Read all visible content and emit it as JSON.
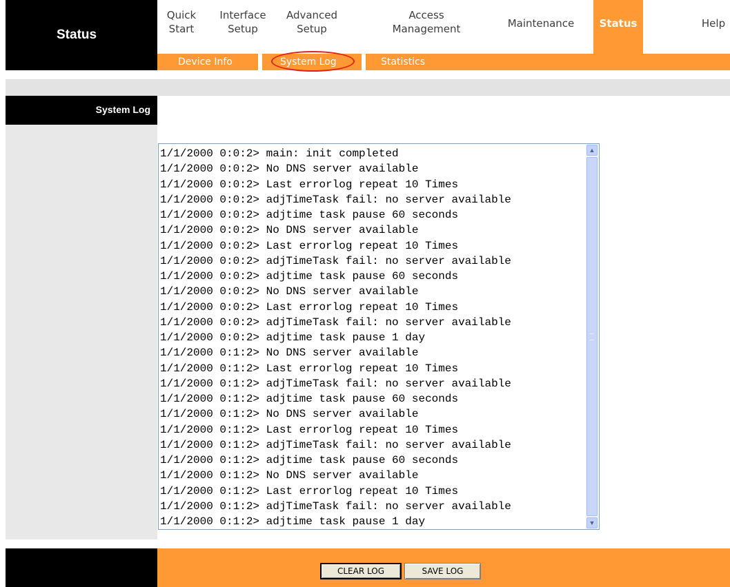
{
  "brand": {
    "title": "Status"
  },
  "topnav": [
    {
      "label": "Quick\nStart"
    },
    {
      "label": "Interface\nSetup"
    },
    {
      "label": "Advanced\nSetup"
    },
    {
      "label": "Access\nManagement"
    },
    {
      "label": "Maintenance"
    },
    {
      "label": "Status"
    },
    {
      "label": "Help"
    }
  ],
  "subnav": {
    "device_info": "Device Info",
    "system_log": "System Log",
    "statistics": "Statistics"
  },
  "section": {
    "label": "System Log"
  },
  "log": {
    "lines": [
      "1/1/2000 0:0:2> main: init completed",
      "1/1/2000 0:0:2> No DNS server available",
      "1/1/2000 0:0:2> Last errorlog repeat 10 Times",
      "1/1/2000 0:0:2> adjTimeTask fail: no server available",
      "1/1/2000 0:0:2> adjtime task pause 60 seconds",
      "1/1/2000 0:0:2> No DNS server available",
      "1/1/2000 0:0:2> Last errorlog repeat 10 Times",
      "1/1/2000 0:0:2> adjTimeTask fail: no server available",
      "1/1/2000 0:0:2> adjtime task pause 60 seconds",
      "1/1/2000 0:0:2> No DNS server available",
      "1/1/2000 0:0:2> Last errorlog repeat 10 Times",
      "1/1/2000 0:0:2> adjTimeTask fail: no server available",
      "1/1/2000 0:0:2> adjtime task pause 1 day",
      "1/1/2000 0:1:2> No DNS server available",
      "1/1/2000 0:1:2> Last errorlog repeat 10 Times",
      "1/1/2000 0:1:2> adjTimeTask fail: no server available",
      "1/1/2000 0:1:2> adjtime task pause 60 seconds",
      "1/1/2000 0:1:2> No DNS server available",
      "1/1/2000 0:1:2> Last errorlog repeat 10 Times",
      "1/1/2000 0:1:2> adjTimeTask fail: no server available",
      "1/1/2000 0:1:2> adjtime task pause 60 seconds",
      "1/1/2000 0:1:2> No DNS server available",
      "1/1/2000 0:1:2> Last errorlog repeat 10 Times",
      "1/1/2000 0:1:2> adjTimeTask fail: no server available",
      "1/1/2000 0:1:2> adjtime task pause 1 day"
    ]
  },
  "buttons": {
    "clear": "CLEAR LOG",
    "save": "SAVE LOG"
  },
  "colors": {
    "accent": "#ff9933",
    "highlight_ring": "#e0201a"
  },
  "icons": {
    "scroll_up": "chevron-up-icon",
    "scroll_down": "chevron-down-icon"
  }
}
